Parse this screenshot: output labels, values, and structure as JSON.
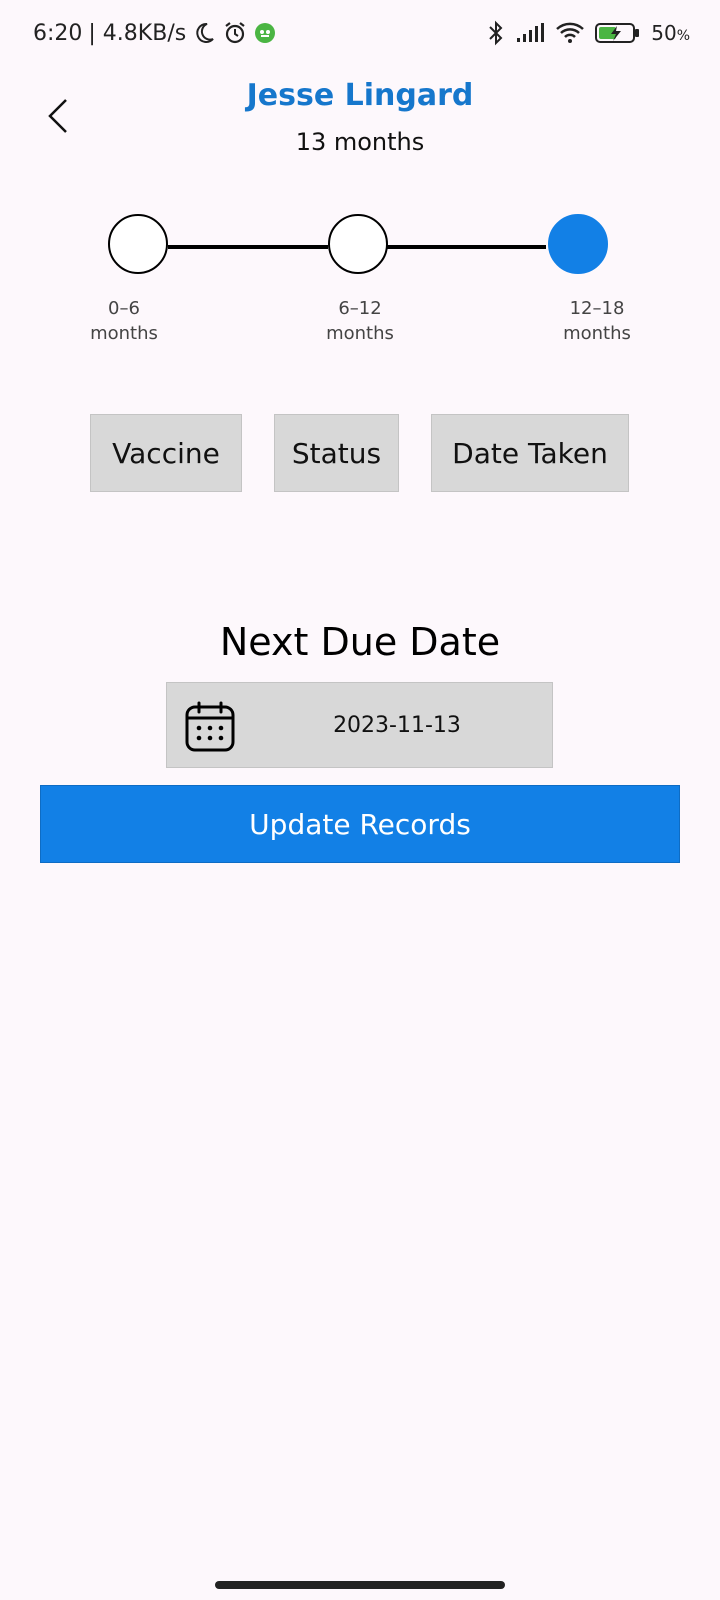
{
  "status_bar": {
    "time": "6:20",
    "network_speed": "| 4.8KB/s",
    "battery_percent": "50",
    "battery_unit": "%",
    "icons": [
      "moon-icon",
      "alarm-icon",
      "app-notification-icon",
      "bluetooth-icon",
      "signal-icon",
      "wifi-icon",
      "battery-charging-icon"
    ]
  },
  "header": {
    "back_icon": "chevron-left-icon",
    "child_name": "Jesse Lingard",
    "child_age": "13 months"
  },
  "stepper": {
    "steps": [
      {
        "range": "0–6",
        "unit": "months",
        "active": false
      },
      {
        "range": "6–12",
        "unit": "months",
        "active": false
      },
      {
        "range": "12–18",
        "unit": "months",
        "active": true
      }
    ]
  },
  "table_headers": {
    "vaccine": "Vaccine",
    "status": "Status",
    "date_taken": "Date Taken"
  },
  "next_due": {
    "title": "Next Due Date",
    "date": "2023-11-13",
    "icon": "calendar-icon"
  },
  "actions": {
    "update_label": "Update Records"
  },
  "colors": {
    "accent": "#1280e6",
    "name_color": "#1677cc",
    "background": "#fdf8fc",
    "box_gray": "#d8d8d8"
  }
}
